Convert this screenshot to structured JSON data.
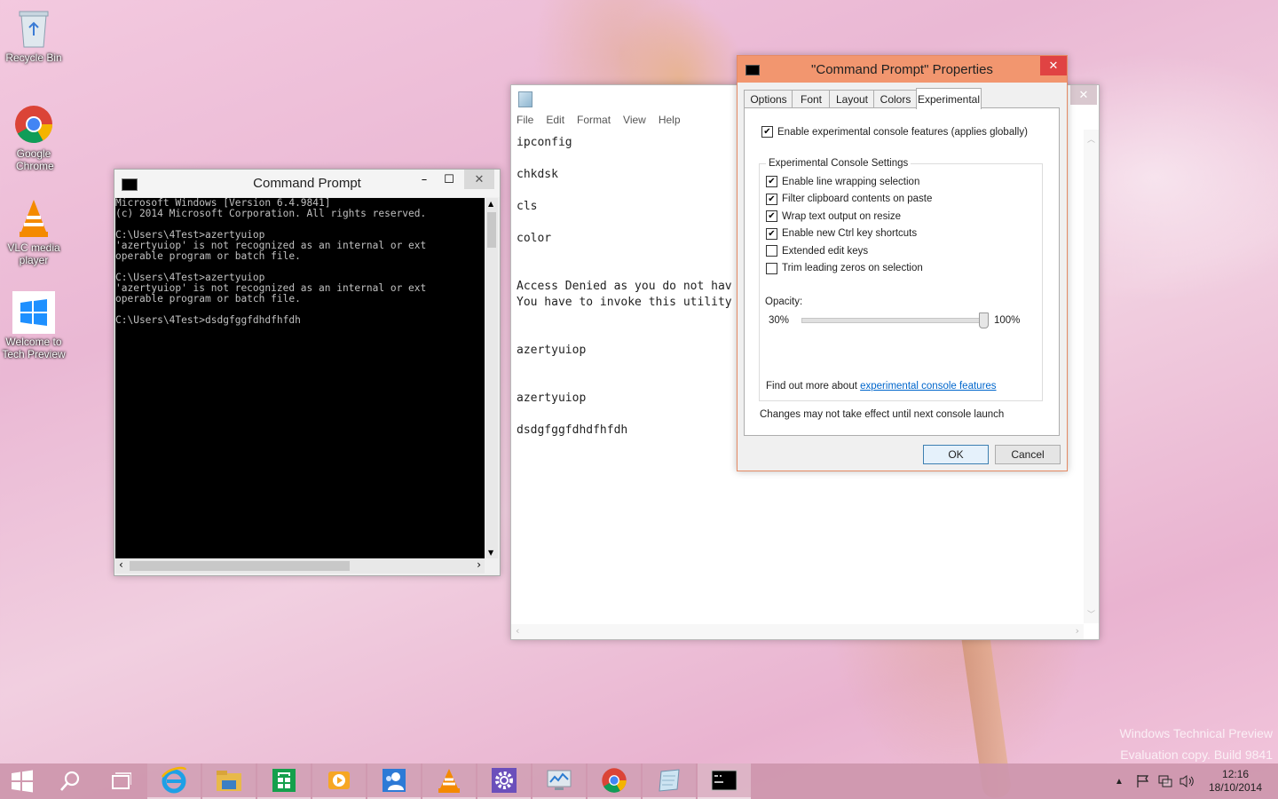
{
  "desktop": {
    "icons": [
      {
        "label": "Recycle Bin",
        "icon": "recycle-bin-icon"
      },
      {
        "label": "Google Chrome",
        "icon": "chrome-icon"
      },
      {
        "label": "VLC media player",
        "icon": "vlc-icon"
      },
      {
        "label": "Welcome to Tech Preview",
        "icon": "windows-logo-icon"
      }
    ],
    "watermark_line1": "Windows Technical Preview",
    "watermark_line2": "Evaluation copy. Build 9841"
  },
  "cmd": {
    "title": "Command Prompt",
    "lines": [
      "Microsoft Windows [Version 6.4.9841]",
      "(c) 2014 Microsoft Corporation. All rights reserved.",
      "",
      "C:\\Users\\4Test>azertyuiop",
      "'azertyuiop' is not recognized as an internal or ext",
      "operable program or batch file.",
      "",
      "C:\\Users\\4Test>azertyuiop",
      "'azertyuiop' is not recognized as an internal or ext",
      "operable program or batch file.",
      "",
      "C:\\Users\\4Test>dsdgfggfdhdfhfdh"
    ]
  },
  "notepad": {
    "menu": [
      "File",
      "Edit",
      "Format",
      "View",
      "Help"
    ],
    "lines": [
      "ipconfig",
      "",
      "chkdsk",
      "",
      "cls",
      "",
      "color",
      "",
      "",
      "Access Denied as you do not hav",
      "You have to invoke this utility",
      "",
      "",
      "azertyuiop",
      "",
      "",
      "azertyuiop",
      "",
      "dsdgfggfdhdfhfdh"
    ]
  },
  "props": {
    "title": "\"Command Prompt\" Properties",
    "tabs": [
      "Options",
      "Font",
      "Layout",
      "Colors",
      "Experimental"
    ],
    "active_tab": "Experimental",
    "enable_experimental": {
      "label": "Enable experimental console features (applies globally)",
      "checked": true
    },
    "group_label": "Experimental Console Settings",
    "settings": [
      {
        "label": "Enable line wrapping selection",
        "checked": true
      },
      {
        "label": "Filter clipboard contents on paste",
        "checked": true
      },
      {
        "label": "Wrap text output on resize",
        "checked": true
      },
      {
        "label": "Enable new Ctrl key shortcuts",
        "checked": true
      },
      {
        "label": "Extended edit keys",
        "checked": false
      },
      {
        "label": "Trim leading zeros on selection",
        "checked": false
      }
    ],
    "opacity_label": "Opacity:",
    "opacity_min": "30%",
    "opacity_max": "100%",
    "opacity_value_percent": 100,
    "find_out_prefix": "Find out more about ",
    "find_out_link": "experimental console features",
    "note": "Changes may not take effect until next console launch",
    "ok_label": "OK",
    "cancel_label": "Cancel"
  },
  "taskbar": {
    "apps": [
      "start-icon",
      "search-icon",
      "task-view-icon",
      "internet-explorer-icon",
      "file-explorer-icon",
      "store-icon",
      "video-icon",
      "people-icon",
      "vlc-icon",
      "settings-icon",
      "resource-monitor-icon",
      "chrome-icon",
      "notepad-icon",
      "command-prompt-icon"
    ],
    "time": "12:16",
    "date": "18/10/2014"
  },
  "colors": {
    "accent": "#f2966f",
    "taskbar": "#cd96ac",
    "link": "#0066cc"
  }
}
